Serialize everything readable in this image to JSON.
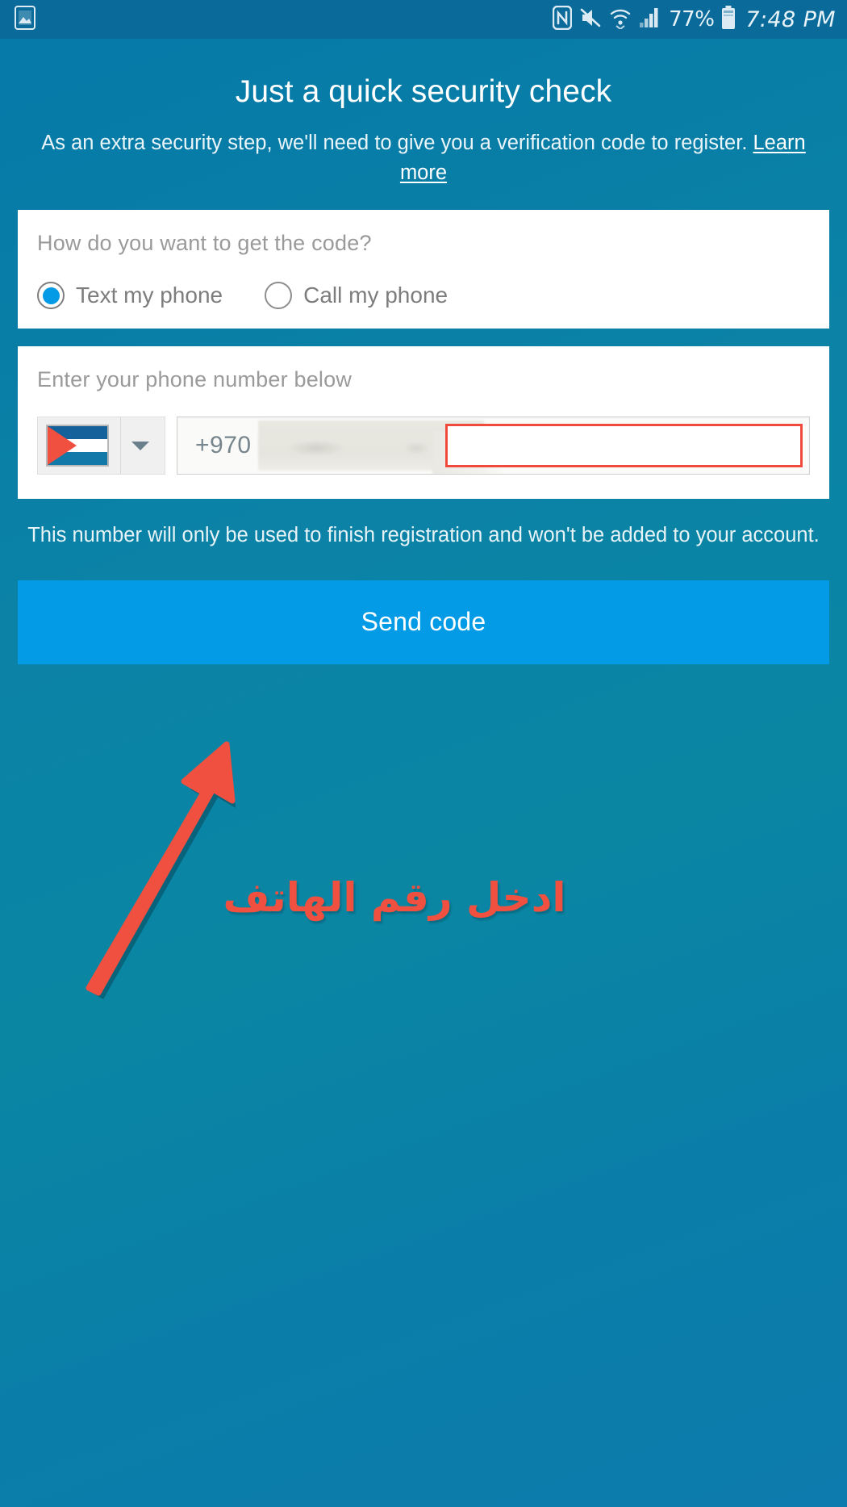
{
  "status_bar": {
    "left_icons": [
      "gallery-image-icon"
    ],
    "right_icons": [
      "nfc-icon",
      "volume-muted-icon",
      "wifi-icon",
      "cellular-signal-icon"
    ],
    "battery_percent": "77%",
    "battery_icon": "battery-icon",
    "time": "7:48 PM"
  },
  "header": {
    "title": "Just a quick security check",
    "subtitle_text": "As an extra security step, we'll need to give you a verification code to register. ",
    "learn_more_label": "Learn more"
  },
  "method_card": {
    "label": "How do you want to get the code?",
    "options": [
      {
        "label": "Text my phone",
        "selected": true
      },
      {
        "label": "Call my phone",
        "selected": false
      }
    ]
  },
  "phone_card": {
    "label": "Enter your phone number below",
    "country": {
      "flag_icon": "palestine-flag-icon",
      "dropdown_icon": "chevron-down-icon"
    },
    "dial_code": "+970",
    "phone_value": "",
    "phone_placeholder": ""
  },
  "disclaimer": "This number will only be used to finish registration and won't be added to your account.",
  "actions": {
    "send_code_label": "Send code"
  },
  "annotations": {
    "arabic_note": "ادخل رقم الهاتف",
    "arrow_icon": "red-arrow-up-right-icon",
    "highlight_box_icon": "red-rectangle-highlight-icon"
  },
  "colors": {
    "background_top": "#0579a8",
    "background_bottom": "#0d7bad",
    "status_bar": "#0a6b9b",
    "card": "#ffffff",
    "accent_blue": "#039BE5",
    "annotation_red": "#f0503f",
    "muted_text": "#9a9a9a"
  }
}
